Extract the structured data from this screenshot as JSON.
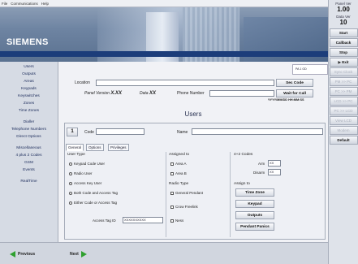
{
  "menu": [
    "File",
    "Communications",
    "Help"
  ],
  "brand": "SIEMENS",
  "right_panel": {
    "panel_ver_label": "Panel Ver",
    "panel_ver_value": "1.00",
    "data_ver_label": "Data Ver",
    "data_ver_value": "10",
    "buttons": [
      {
        "label": "Start",
        "enabled": true
      },
      {
        "label": "Callback",
        "enabled": true
      },
      {
        "label": "Stop",
        "enabled": true
      },
      {
        "label": "Exit",
        "enabled": true
      },
      {
        "label": "Sync Clock",
        "enabled": false
      },
      {
        "label": "PM >> PC",
        "enabled": false
      },
      {
        "label": "PC >> PM",
        "enabled": false
      },
      {
        "label": "LCD >> PC",
        "enabled": false
      },
      {
        "label": "PC >> LCD",
        "enabled": false
      },
      {
        "label": "View LCD",
        "enabled": false
      },
      {
        "label": "Modem",
        "enabled": false
      },
      {
        "label": "Default",
        "enabled": true
      }
    ]
  },
  "sidebar": {
    "group1": [
      "Users",
      "Outputs",
      "Areas",
      "Keypads",
      "Keyswitches",
      "Zones",
      "Time Zones"
    ],
    "group2": [
      "Dialler",
      "Telephone Numbers",
      "Direct Options"
    ],
    "group3": [
      "Miscellaneous",
      "4 plus 2 Codes",
      "GSM",
      "Events"
    ],
    "group4": [
      "RealTime"
    ]
  },
  "header": {
    "location_label": "Location",
    "panel_version_label": "Panel Version",
    "panel_version_value": "X.XX",
    "data_label": "Data",
    "data_value": "XX",
    "phone_label": "Phone Number",
    "sec_code_button": "Sec Code",
    "wait_call_button": "Wait for Call",
    "date_format": "YYYY/MM/DD HH:MM:SS",
    "pager_mini": "PA 1 OD"
  },
  "page_title": "Users",
  "form": {
    "index": "1",
    "code_label": "Code",
    "name_label": "Name",
    "tabs": [
      "General",
      "Options",
      "Privileges"
    ],
    "user_type_label": "User Type",
    "user_types": [
      "Keypad Code User",
      "Radio User",
      "Access Key User",
      "Both Code and Access Tag",
      "Either Code or Access Tag"
    ],
    "access_tag_label": "Access Tag ID",
    "access_tag_value": "XXXXXXXXXX",
    "assigned_label": "Assigned to",
    "areas": [
      "Area A",
      "Area B"
    ],
    "radio_type_label": "Radio Type",
    "radio_types": [
      "General Pendant",
      "Crow Freelink",
      "Ness"
    ],
    "codes_label": "4+2 Codes",
    "arm_label": "Arm",
    "arm_value": "XX",
    "disarm_label": "Disarm",
    "disarm_value": "XX",
    "assign_label": "Assign to",
    "assign_buttons": [
      "Time Zone",
      "Keypad",
      "Outputs",
      "Pendant Panics"
    ]
  },
  "nav": {
    "previous": "Previous",
    "next": "Next"
  }
}
